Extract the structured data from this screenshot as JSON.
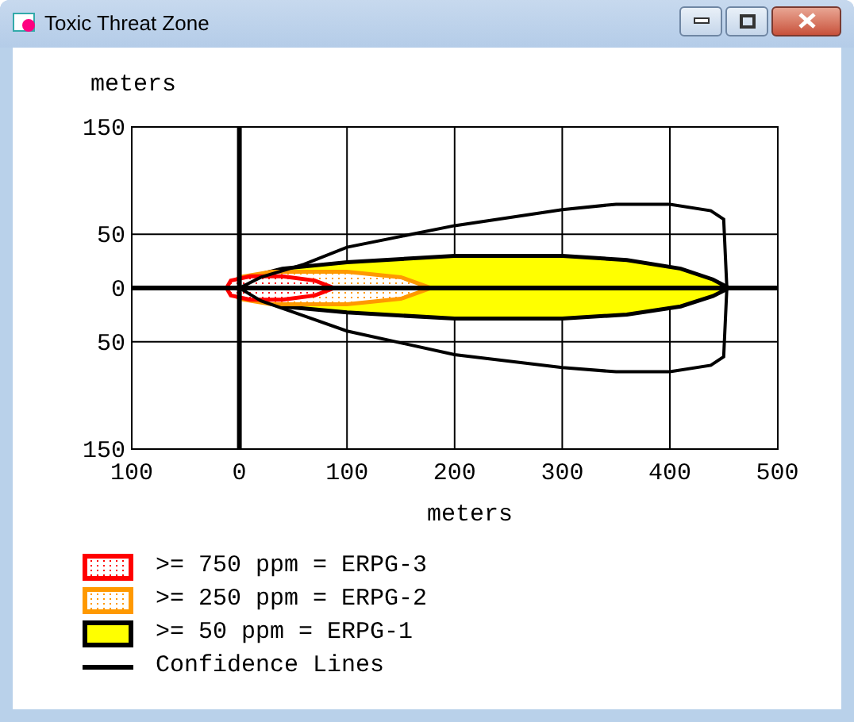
{
  "window": {
    "title": "Toxic Threat Zone"
  },
  "plot": {
    "ylabel": "meters",
    "xlabel": "meters",
    "yticks": [
      "150",
      "50",
      "0",
      "50",
      "150"
    ],
    "xticks": [
      "100",
      "0",
      "100",
      "200",
      "300",
      "400",
      "500"
    ]
  },
  "legend": [
    {
      "kind": "dotted-zone",
      "color": "#ff0000",
      "label": ">= 750 ppm = ERPG-3"
    },
    {
      "kind": "dotted-zone",
      "color": "#ff9900",
      "label": ">= 250 ppm = ERPG-2"
    },
    {
      "kind": "solid-zone",
      "color": "#ffff00",
      "label": ">= 50 ppm = ERPG-1"
    },
    {
      "kind": "line",
      "color": "#000000",
      "label": "Confidence Lines"
    }
  ]
}
